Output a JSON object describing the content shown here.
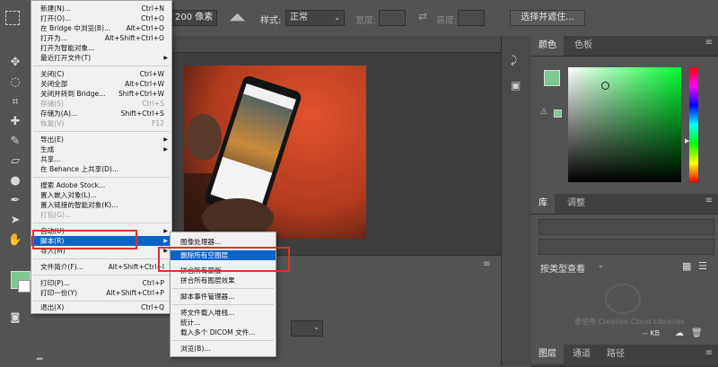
{
  "options_bar": {
    "size_text": "200 像素",
    "style_label": "样式:",
    "style_value": "正常",
    "width_label": "宽度:",
    "height_label": "高度:",
    "select_mask_button": "选择并遮住..."
  },
  "file_menu": {
    "items": [
      {
        "label": "新建(N)...",
        "shortcut": "Ctrl+N"
      },
      {
        "label": "打开(O)...",
        "shortcut": "Ctrl+O"
      },
      {
        "label": "在 Bridge 中浏览(B)...",
        "shortcut": "Alt+Ctrl+O"
      },
      {
        "label": "打开为...",
        "shortcut": "Alt+Shift+Ctrl+O"
      },
      {
        "label": "打开为智能对象...",
        "shortcut": ""
      },
      {
        "label": "最近打开文件(T)",
        "shortcut": ""
      },
      {
        "label": "关闭(C)",
        "shortcut": "Ctrl+W"
      },
      {
        "label": "关闭全部",
        "shortcut": "Alt+Ctrl+W"
      },
      {
        "label": "关闭并转到 Bridge...",
        "shortcut": "Shift+Ctrl+W"
      },
      {
        "label": "存储(S)",
        "shortcut": "Ctrl+S"
      },
      {
        "label": "存储为(A)...",
        "shortcut": "Shift+Ctrl+S"
      },
      {
        "label": "恢复(V)",
        "shortcut": "F12"
      },
      {
        "label": "导出(E)",
        "shortcut": ""
      },
      {
        "label": "生成",
        "shortcut": ""
      },
      {
        "label": "共享...",
        "shortcut": ""
      },
      {
        "label": "在 Behance 上共享(D)...",
        "shortcut": ""
      },
      {
        "label": "搜索 Adobe Stock...",
        "shortcut": ""
      },
      {
        "label": "置入嵌入对象(L)...",
        "shortcut": ""
      },
      {
        "label": "置入链接的智能对象(K)...",
        "shortcut": ""
      },
      {
        "label": "打包(G)...",
        "shortcut": ""
      },
      {
        "label": "自动(U)",
        "shortcut": ""
      },
      {
        "label": "脚本(R)",
        "shortcut": ""
      },
      {
        "label": "导入(M)",
        "shortcut": ""
      },
      {
        "label": "文件简介(F)...",
        "shortcut": "Alt+Shift+Ctrl+I"
      },
      {
        "label": "打印(P)...",
        "shortcut": "Ctrl+P"
      },
      {
        "label": "打印一份(Y)",
        "shortcut": "Alt+Shift+Ctrl+P"
      },
      {
        "label": "退出(X)",
        "shortcut": "Ctrl+Q"
      }
    ]
  },
  "scripts_submenu": {
    "items": [
      "图像处理器...",
      "删除所有空图层",
      "拼合所有蒙版",
      "拼合所有图层效果",
      "脚本事件管理器...",
      "将文件载入堆栈...",
      "统计...",
      "载入多个 DICOM 文件...",
      "浏览(B)..."
    ]
  },
  "color_panel": {
    "tabs": [
      "颜色",
      "色板"
    ],
    "fg_color": "#7cc98f",
    "bg_color": "#ffffff"
  },
  "library_panel": {
    "tabs": [
      "库",
      "调整"
    ],
    "view_by": "按类型查看",
    "cc_text": "要使用 Creative Cloud Libraries",
    "size_text": "-- KB"
  },
  "layers_panel": {
    "tabs": [
      "图层",
      "通道",
      "路径"
    ]
  },
  "colors": {
    "highlight": "#0a64c8",
    "annotation_red": "#e0302a"
  }
}
